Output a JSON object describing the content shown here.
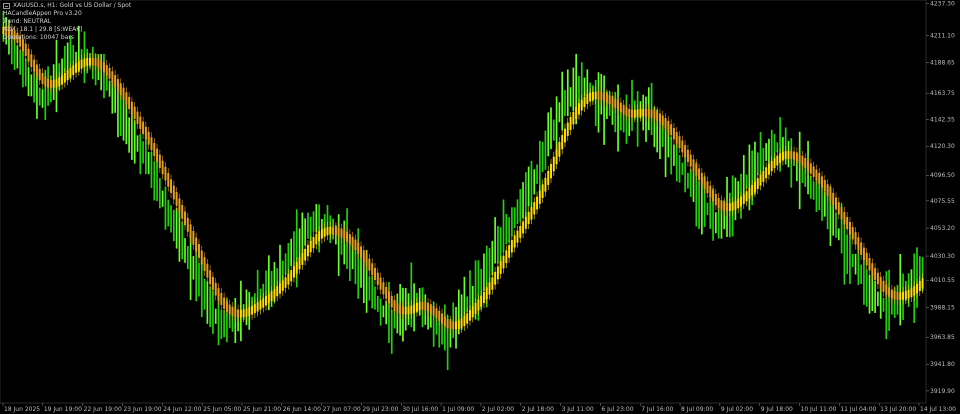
{
  "info": {
    "symbol_line": "XAUUSD.s, H1:  Gold vs US Dollar / Spot",
    "indicator_line": "HACandleAppen Pro v3.20",
    "line3": "Trend: NEUTRAL",
    "line4": "ADX: 18.1 | 29.8 [S:WEAK]",
    "line5": "Operations: 10047 bars"
  },
  "colors": {
    "background": "#000000",
    "green": "#22d10b",
    "bright_green": "#6aff2a",
    "orange": "#e8a020",
    "yellow": "#ffe000",
    "axis_text": "#bdbdbd"
  },
  "chart_data": {
    "type": "candlestick",
    "price_axis": [
      "4237.30",
      "4211.10",
      "4188.65",
      "4163.75",
      "4142.35",
      "4120.30",
      "4096.50",
      "4075.55",
      "4053.20",
      "4030.30",
      "4010.55",
      "3988.15",
      "3963.85",
      "3941.80",
      "3919.90"
    ],
    "ylim": [
      3910,
      4240
    ],
    "time_axis": [
      "18 Jun 2025",
      "19 Jun 19:00",
      "22 Jun 19:00",
      "23 Jun 19:00",
      "24 Jun 12:00",
      "25 Jun 05:00",
      "25 Jun 21:00",
      "26 Jun 14:00",
      "27 Jun 07:00",
      "29 Jul 23:00",
      "30 Jul 16:00",
      "1 Jul 09:00",
      "2 Jul 02:00",
      "2 Jul 18:00",
      "3 Jul 11:00",
      "6 Jul 23:00",
      "7 Jul 16:00",
      "8 Jul 09:00",
      "9 Jul 02:00",
      "9 Jul 18:00",
      "10 Jul 11:00",
      "11 Jul 04:00",
      "13 Jul 20:00",
      "14 Jul 13:00"
    ],
    "close_path": [
      4215,
      4200,
      4170,
      4160,
      4175,
      4190,
      4195,
      4188,
      4170,
      4150,
      4130,
      4110,
      4085,
      4060,
      4035,
      4010,
      3985,
      3975,
      3980,
      3990,
      4000,
      4010,
      4025,
      4045,
      4058,
      4055,
      4045,
      4030,
      4010,
      3990,
      3975,
      3985,
      3995,
      3980,
      3965,
      3975,
      3995,
      4010,
      4035,
      4055,
      4070,
      4090,
      4120,
      4150,
      4165,
      4170,
      4160,
      4150,
      4140,
      4150,
      4145,
      4130,
      4110,
      4090,
      4075,
      4060,
      4070,
      4085,
      4100,
      4115,
      4120,
      4110,
      4095,
      4080,
      4060,
      4040,
      4020,
      4000,
      3990,
      3995,
      4005,
      4020
    ]
  }
}
